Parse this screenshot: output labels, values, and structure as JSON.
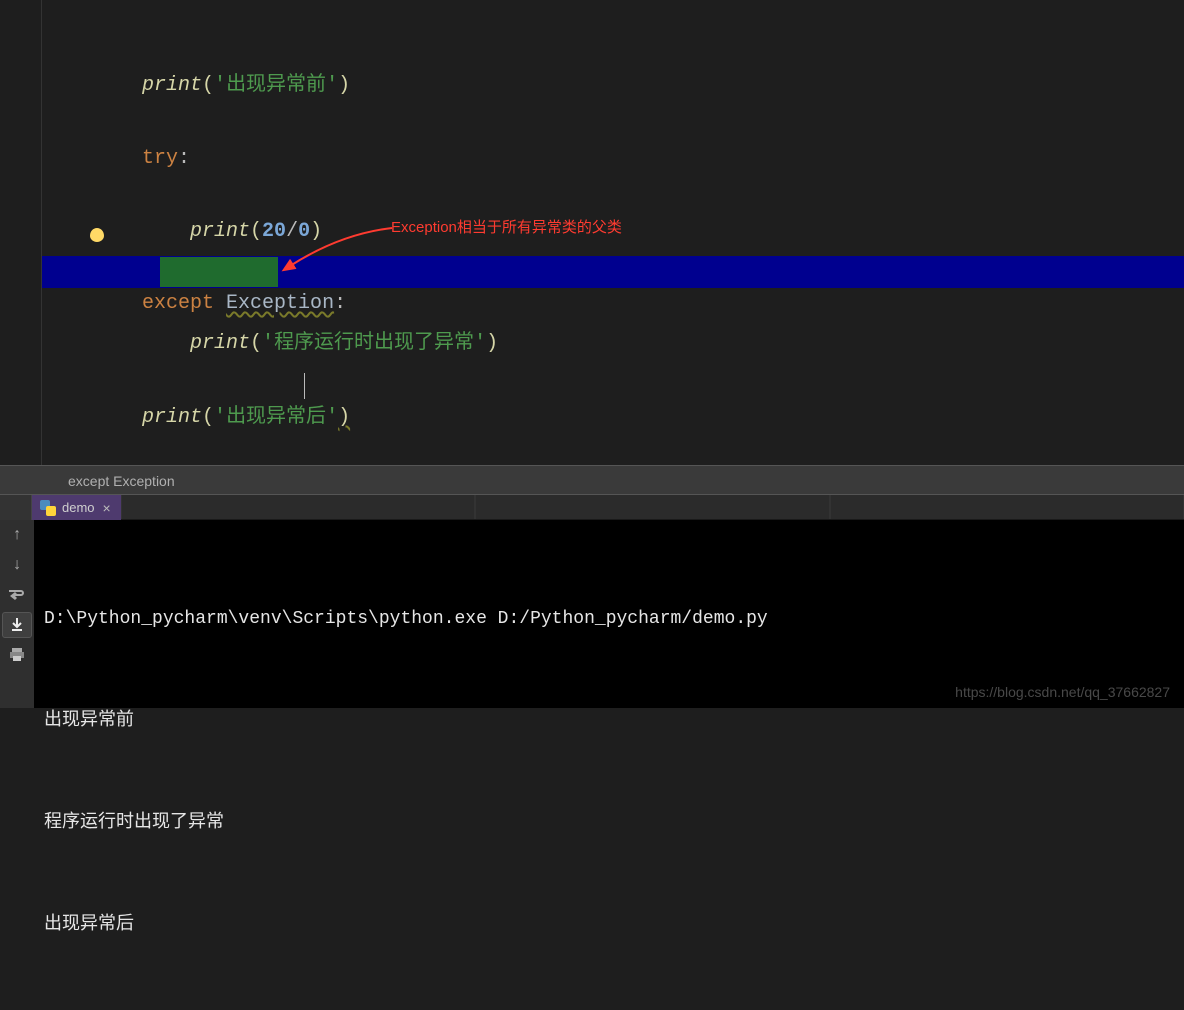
{
  "code": {
    "line1": {
      "fn": "print",
      "str": "出现异常前"
    },
    "line3": {
      "kw": "try"
    },
    "line5": {
      "fn": "print",
      "n1": "20",
      "n2": "0"
    },
    "line7": {
      "kw": "except",
      "cls": "Exception"
    },
    "line8": {
      "fn": "print",
      "str": "程序运行时出现了异常"
    },
    "line10": {
      "fn": "print",
      "str": "出现异常后"
    }
  },
  "annotation": "Exception相当于所有异常类的父类",
  "breadcrumb": "except Exception",
  "tab": {
    "label": "demo",
    "close": "×"
  },
  "console": {
    "cmd": "D:\\Python_pycharm\\venv\\Scripts\\python.exe D:/Python_pycharm/demo.py",
    "l1": "出现异常前",
    "l2": "程序运行时出现了异常",
    "l3": "出现异常后"
  },
  "watermark": "https://blog.csdn.net/qq_37662827"
}
